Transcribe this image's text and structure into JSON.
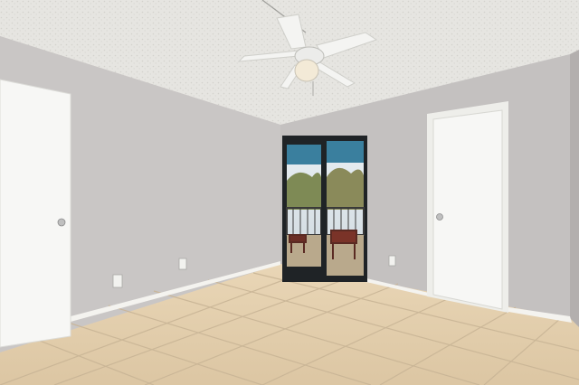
{
  "scene": {
    "colors": {
      "ceiling": "#e6e5e1",
      "wall_left": "#c9c6c5",
      "wall_back": "#c4c1c0",
      "wall_right": "#b9b5b4",
      "floor": "#e4cfae",
      "grout": "#c9b596",
      "baseboard": "#f4f3ef",
      "door": "#f7f7f5",
      "door_frame": "#1f2326",
      "sky": "#dfe8ee",
      "trees": "#8a8a5a",
      "fan": "#f4f4f2"
    },
    "icons": {
      "fan": "ceiling-fan-icon",
      "outlet": "outlet-icon",
      "knob": "door-knob-icon"
    }
  }
}
